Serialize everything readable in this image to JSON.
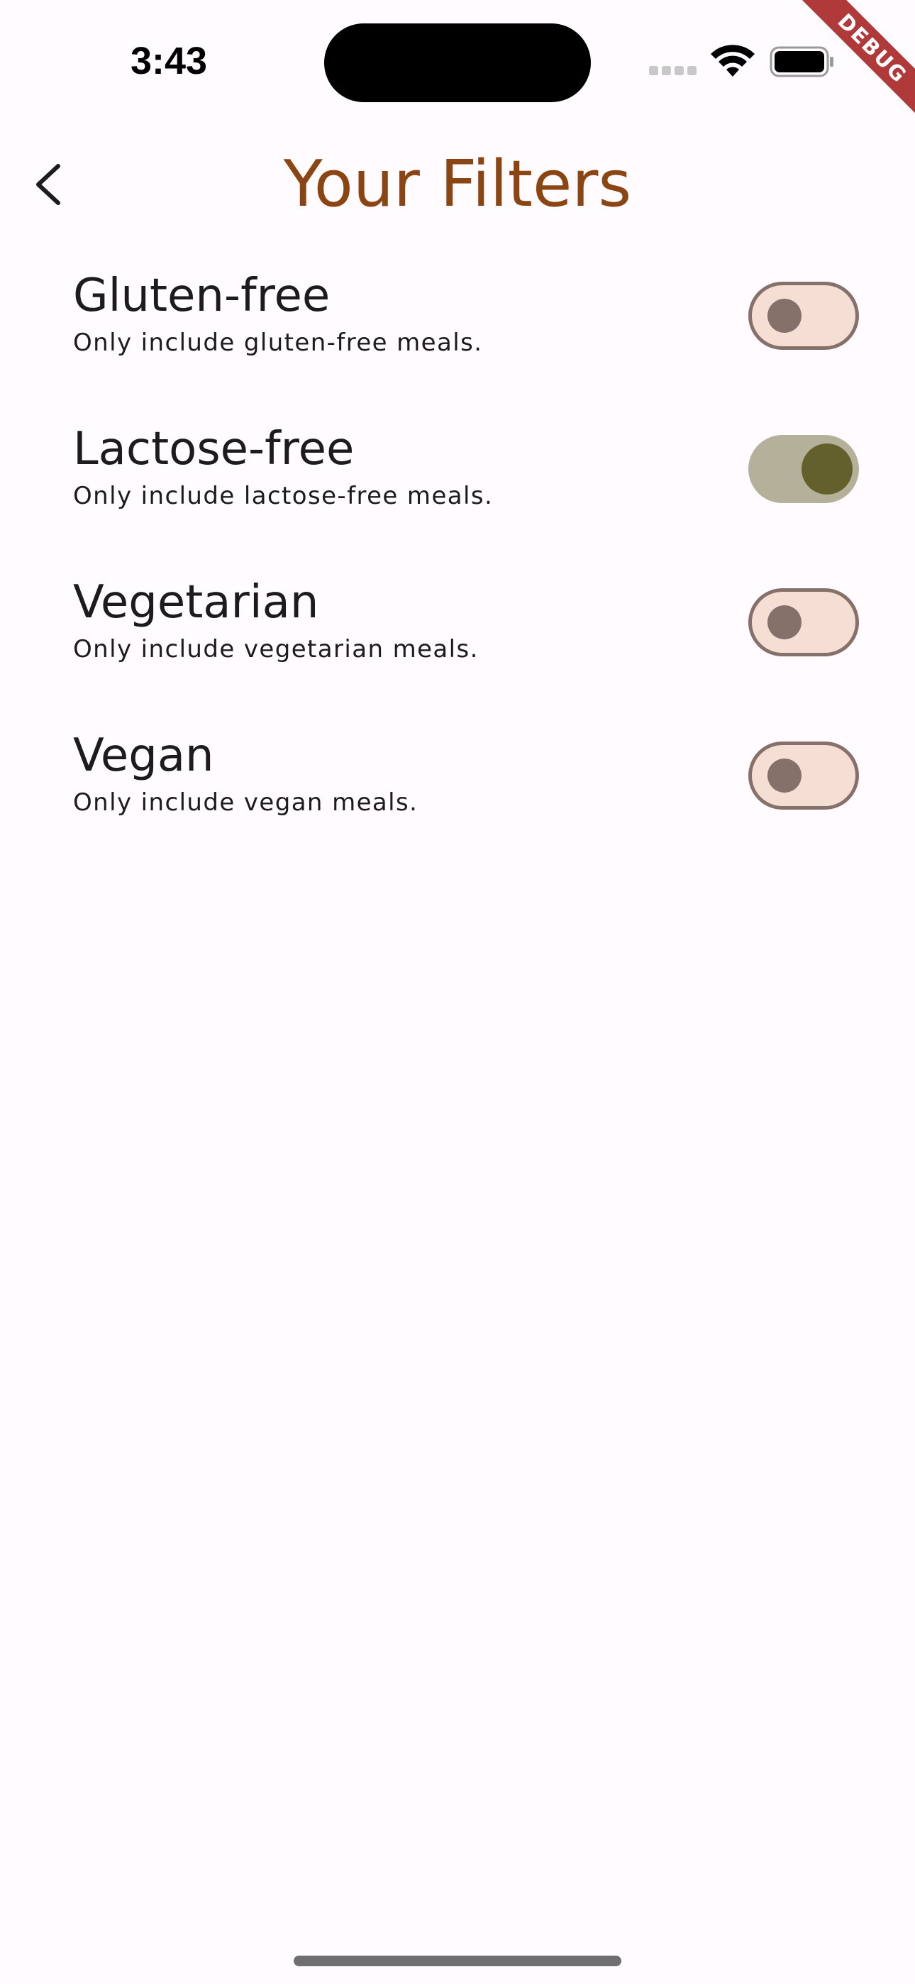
{
  "status_bar": {
    "time": "3:43"
  },
  "debug_banner": "DEBUG",
  "app_bar": {
    "title": "Your Filters",
    "back_icon": "chevron-left-icon"
  },
  "filters": [
    {
      "title": "Gluten-free",
      "subtitle": "Only include gluten-free meals.",
      "enabled": false
    },
    {
      "title": "Lactose-free",
      "subtitle": "Only include lactose-free meals.",
      "enabled": true
    },
    {
      "title": "Vegetarian",
      "subtitle": "Only include vegetarian meals.",
      "enabled": false
    },
    {
      "title": "Vegan",
      "subtitle": "Only include vegan meals.",
      "enabled": false
    }
  ],
  "colors": {
    "background": "#fffbfe",
    "title": "#8b4513",
    "text": "#1d1b20",
    "switch_off_track": "#f5dfd5",
    "switch_off_outline": "#86706a",
    "switch_on_track": "#b5b09a",
    "switch_on_knob": "#63602e",
    "debug_ribbon": "#b03a3a"
  }
}
